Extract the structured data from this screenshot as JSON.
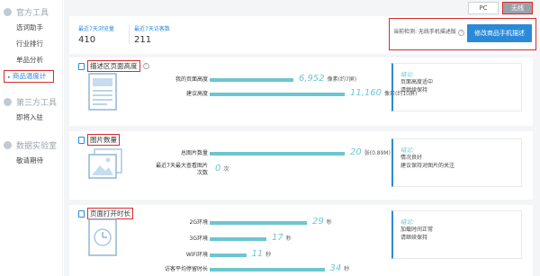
{
  "sidebar": {
    "groups": [
      {
        "title": "官方工具",
        "items": [
          "选词助手",
          "行业排行",
          "单品分析",
          "商品温度计"
        ]
      },
      {
        "title": "第三方工具",
        "items": [
          "即将入驻"
        ]
      },
      {
        "title": "数据实验室",
        "items": [
          "敬请期待"
        ]
      }
    ]
  },
  "topbar": {
    "pc_label": "PC",
    "mobile_label": "无线"
  },
  "summary": {
    "stat1_label": "最近7天浏览量",
    "stat1_value": "410",
    "stat2_label": "最近7天访客数",
    "stat2_value": "211",
    "detect_text": "当前检测: 无线手机描述版",
    "detect_button": "修改商品手机描述"
  },
  "sections": [
    {
      "title": "描述区页面高度",
      "rows": [
        {
          "label": "我的页面高度",
          "value": "6,952",
          "unit": "像素(约7屏)",
          "fraction": 0.62
        },
        {
          "label": "建议高度",
          "value": "11,160",
          "unit": "像素(约10屏)",
          "fraction": 1.0
        }
      ],
      "tip_title": "结论:",
      "tip_lines": [
        "页面高度适中",
        "请继续保持"
      ]
    },
    {
      "title": "图片数量",
      "rows": [
        {
          "label": "总图片数量",
          "value": "20",
          "unit": "张(0.89M)",
          "fraction": 1.0
        },
        {
          "label": "最近7天最大查看图片次数",
          "value": "0",
          "unit": "次",
          "fraction": 0.0
        }
      ],
      "tip_title": "结论:",
      "tip_lines": [
        "情况良好",
        "建议保持对图片的关注"
      ]
    },
    {
      "title": "页面打开时长",
      "rows": [
        {
          "label": "2G环境",
          "value": "29",
          "unit": "秒",
          "fraction": 0.72
        },
        {
          "label": "3G环境",
          "value": "17",
          "unit": "秒",
          "fraction": 0.42
        },
        {
          "label": "WiFi环境",
          "value": "11",
          "unit": "秒",
          "fraction": 0.27
        },
        {
          "label": "访客平均停留时长",
          "value": "34",
          "unit": "秒",
          "fraction": 0.85
        }
      ],
      "tip_title": "结论:",
      "tip_lines": [
        "加载时间正常",
        "请继续保持"
      ]
    }
  ],
  "colors": {
    "accent": "#2b8ad8",
    "bar": "#6cc6cf",
    "highlight": "#d92b2b"
  }
}
